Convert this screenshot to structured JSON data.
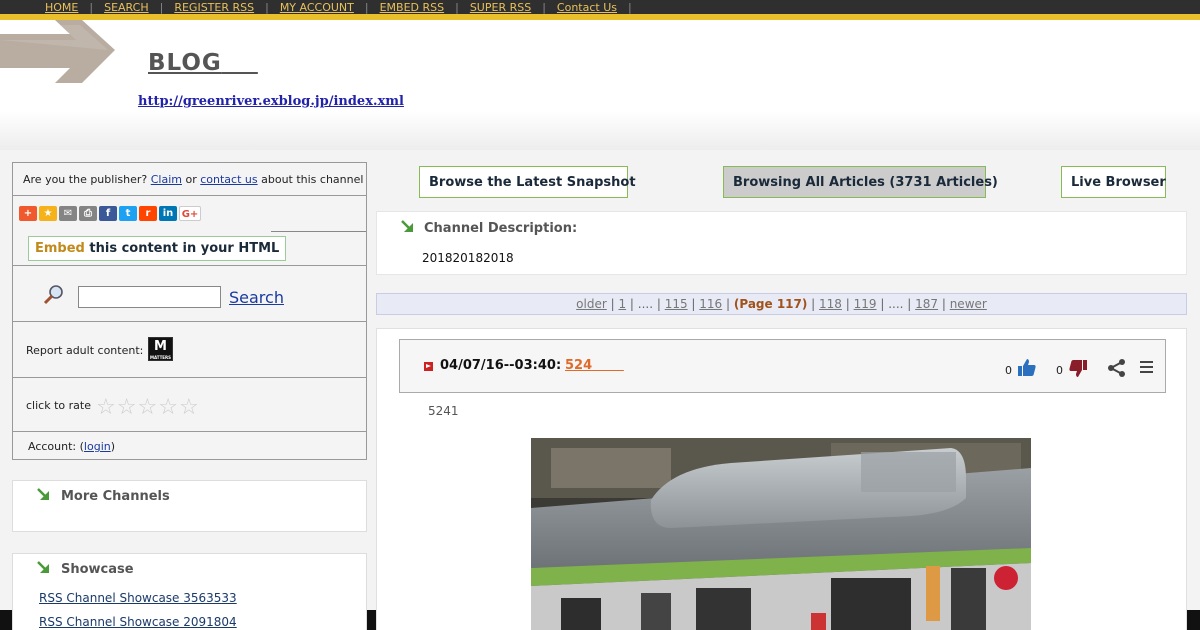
{
  "nav": {
    "items": [
      "HOME",
      "SEARCH",
      "REGISTER RSS",
      "MY ACCOUNT",
      "EMBED RSS",
      "SUPER RSS",
      "Contact Us"
    ]
  },
  "header": {
    "title": "BLOG",
    "url": "http://greenriver.exblog.jp/index.xml"
  },
  "sidebar": {
    "publisher_prefix": "Are you the publisher?",
    "claim": "Claim",
    "or": "or",
    "contact": "contact us",
    "publisher_suffix": "about this channel",
    "embed_word": "Embed",
    "embed_rest": "this content in your HTML",
    "search_label": "Search",
    "adult_label": "Report adult content:",
    "matters_label": "M",
    "matters_sub": "MATTERS",
    "rate_label": "click to rate",
    "account_prefix": "Account: (",
    "login": "login",
    "account_suffix": ")",
    "more_channels": "More Channels",
    "showcase_title": "Showcase",
    "showcase_links": [
      "RSS Channel Showcase 3563533",
      "RSS Channel Showcase 2091804"
    ]
  },
  "main": {
    "latest_snapshot": "Browse the Latest Snapshot",
    "browsing_all": "Browsing All Articles (3731 Articles)",
    "live_browser": "Live Browser",
    "desc_title": "Channel Description:",
    "desc_text": "201820182018",
    "pager": {
      "older": "older",
      "p1": "1",
      "dots1": "....",
      "p115": "115",
      "p116": "116",
      "current": "(Page 117)",
      "p118": "118",
      "p119": "119",
      "dots2": "....",
      "p187": "187",
      "newer": "newer"
    },
    "article": {
      "date": "04/07/16--03:40:",
      "title": "524       ",
      "likes": "0",
      "dislikes": "0",
      "body": "5241"
    }
  },
  "colors": {
    "nav_bg": "#2f2f2f",
    "gold": "#e9bf2c",
    "link": "#1a3aa0",
    "accent_orange": "#e06a2a",
    "green_border": "#88bb55"
  }
}
